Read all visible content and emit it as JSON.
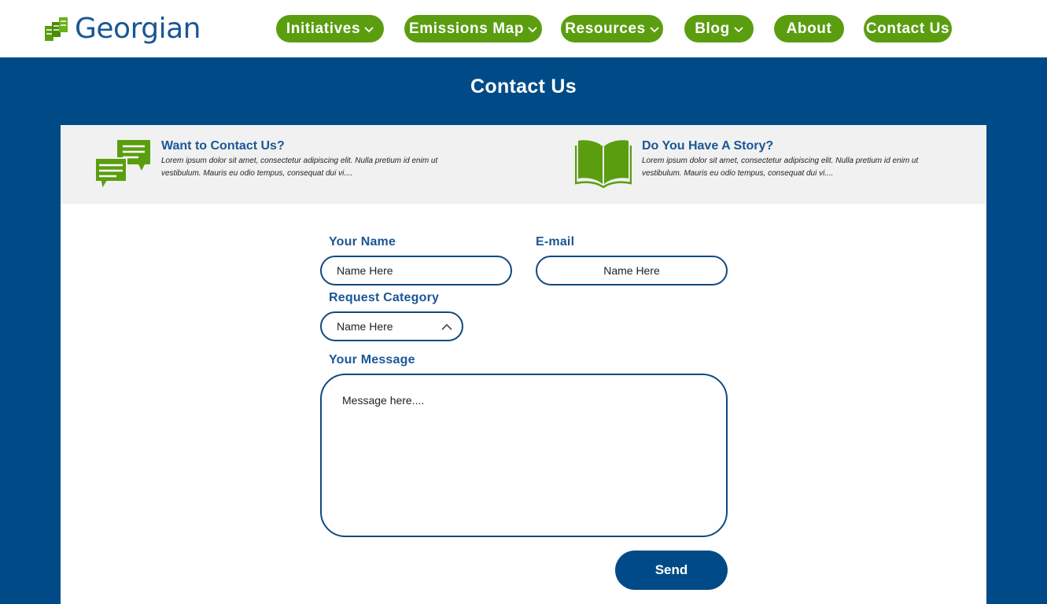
{
  "header": {
    "brand": "Georgian",
    "nav": [
      {
        "label": "Initiatives",
        "has_dropdown": true
      },
      {
        "label": "Emissions Map",
        "has_dropdown": true
      },
      {
        "label": "Resources",
        "has_dropdown": true
      },
      {
        "label": "Blog",
        "has_dropdown": true
      },
      {
        "label": "About",
        "has_dropdown": false
      },
      {
        "label": "Contact Us",
        "has_dropdown": false
      }
    ]
  },
  "page": {
    "title": "Contact Us"
  },
  "info": {
    "contact": {
      "icon": "chat-bubbles-icon",
      "title": "Want to Contact Us?",
      "body": "Lorem ipsum dolor sit amet, consectetur adipiscing elit. Nulla pretium id enim ut vestibulum. Mauris eu odio tempus, consequat dui vi...."
    },
    "story": {
      "icon": "open-book-icon",
      "title": "Do You Have A Story?",
      "body": "Lorem ipsum dolor sit amet, consectetur adipiscing elit. Nulla pretium id enim ut vestibulum. Mauris eu odio tempus, consequat dui vi...."
    }
  },
  "form": {
    "name_label": "Your Name",
    "name_placeholder": "Name Here",
    "email_label": "E-mail",
    "email_placeholder": "Name Here",
    "category_label": "Request Category",
    "category_value": "Name Here",
    "message_label": "Your Message",
    "message_placeholder": "Message here....",
    "send_label": "Send"
  },
  "colors": {
    "brand_blue": "#004b87",
    "nav_green": "#5a9e10",
    "label_blue": "#1a5795",
    "strip_gray": "#f1f1f1"
  }
}
